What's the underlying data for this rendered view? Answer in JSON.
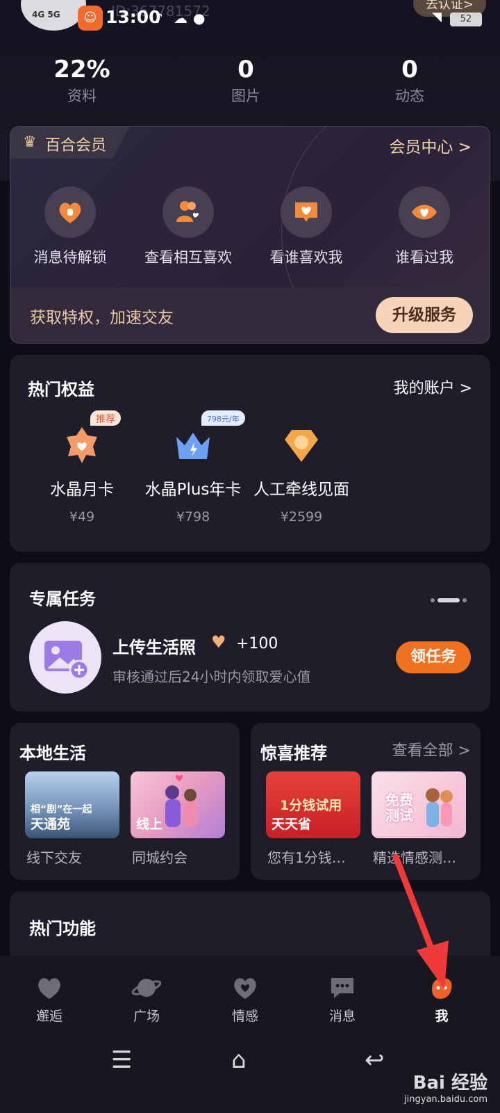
{
  "status_bar": {
    "network": "4G 5G",
    "time": "13:00",
    "battery": "52"
  },
  "profile": {
    "user_id": "ID:367781572",
    "verify_label": "去认证>"
  },
  "stats": [
    {
      "value": "22%",
      "label": "资料"
    },
    {
      "value": "0",
      "label": "图片"
    },
    {
      "value": "0",
      "label": "动态"
    }
  ],
  "vip": {
    "tag": "百合会员",
    "center_link": "会员中心 >",
    "features": [
      {
        "label": "消息待解锁",
        "icon": "lock-heart-icon"
      },
      {
        "label": "查看相互喜欢",
        "icon": "people-heart-icon"
      },
      {
        "label": "看谁喜欢我",
        "icon": "chat-heart-icon"
      },
      {
        "label": "谁看过我",
        "icon": "eye-heart-icon"
      }
    ],
    "slogan": "获取特权，加速交友",
    "upgrade_label": "升级服务"
  },
  "benefits": {
    "title": "热门权益",
    "account_link": "我的账户 >",
    "items": [
      {
        "name": "水晶月卡",
        "price": "¥49",
        "badge": "推荐",
        "icon": "crystal-star-icon"
      },
      {
        "name": "水晶Plus年卡",
        "price": "¥798",
        "badge": "798元/年",
        "icon": "crown-icon"
      },
      {
        "name": "人工牵线见面",
        "price": "¥2599",
        "badge": "",
        "icon": "diamond-badge-icon"
      }
    ]
  },
  "tasks": {
    "title": "专属任务",
    "task_title": "上传生活照",
    "task_reward": "+100",
    "task_desc": "审核通过后24小时内领取爱心值",
    "button": "领任务"
  },
  "local": {
    "title": "本地生活",
    "items": [
      {
        "overlay": "天通苑",
        "caption": "线下交友",
        "poster_text": "相“剧”在一起"
      },
      {
        "overlay": "线上",
        "caption": "同城约会"
      }
    ]
  },
  "surprise": {
    "title": "惊喜推荐",
    "link": "查看全部 >",
    "items": [
      {
        "overlay": "天天省",
        "caption": "您有1分钱…",
        "poster_text": "1分钱试用"
      },
      {
        "overlay": "",
        "caption": "精选情感测…",
        "poster_text": "免费测试"
      }
    ]
  },
  "hot_functions": {
    "title": "热门功能"
  },
  "nav": [
    {
      "label": "邂逅",
      "icon": "heart-icon"
    },
    {
      "label": "广场",
      "icon": "planet-icon"
    },
    {
      "label": "情感",
      "icon": "heart-outline-icon"
    },
    {
      "label": "消息",
      "icon": "message-icon"
    },
    {
      "label": "我",
      "icon": "me-face-icon"
    }
  ],
  "watermark": {
    "brand": "Bai 经验",
    "url": "jingyan.baidu.com"
  },
  "colors": {
    "accent_orange": "#f2711f",
    "vip_gold": "#f2d3ab",
    "annotation_red": "#f03a3a"
  }
}
